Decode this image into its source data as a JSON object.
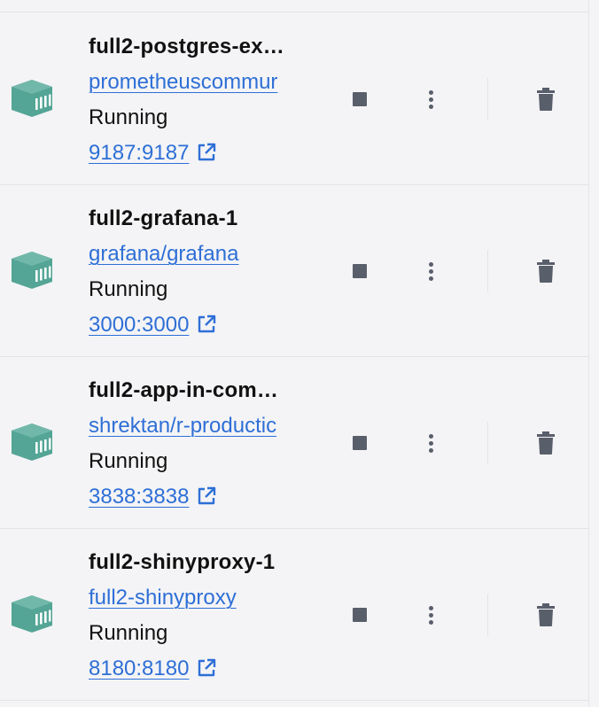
{
  "containers": [
    {
      "name": "full2-postgres-ex…",
      "image": "prometheuscommur",
      "status": "Running",
      "ports": "9187:9187"
    },
    {
      "name": "full2-grafana-1",
      "image": "grafana/grafana",
      "status": "Running",
      "ports": "3000:3000"
    },
    {
      "name": "full2-app-in-com…",
      "image": "shrektan/r-productic",
      "status": "Running",
      "ports": "3838:3838"
    },
    {
      "name": "full2-shinyproxy-1",
      "image": "full2-shinyproxy",
      "status": "Running",
      "ports": "8180:8180"
    }
  ],
  "icons": {
    "container": "container-icon",
    "open_external": "open-external-icon",
    "stop": "stop-icon",
    "more": "more-vertical-icon",
    "delete": "trash-icon"
  },
  "colors": {
    "container_icon": "#54a596",
    "link": "#2e6fd6",
    "action_icon": "#595e6b",
    "background": "#f4f4f6",
    "divider": "#e3e4e8"
  }
}
